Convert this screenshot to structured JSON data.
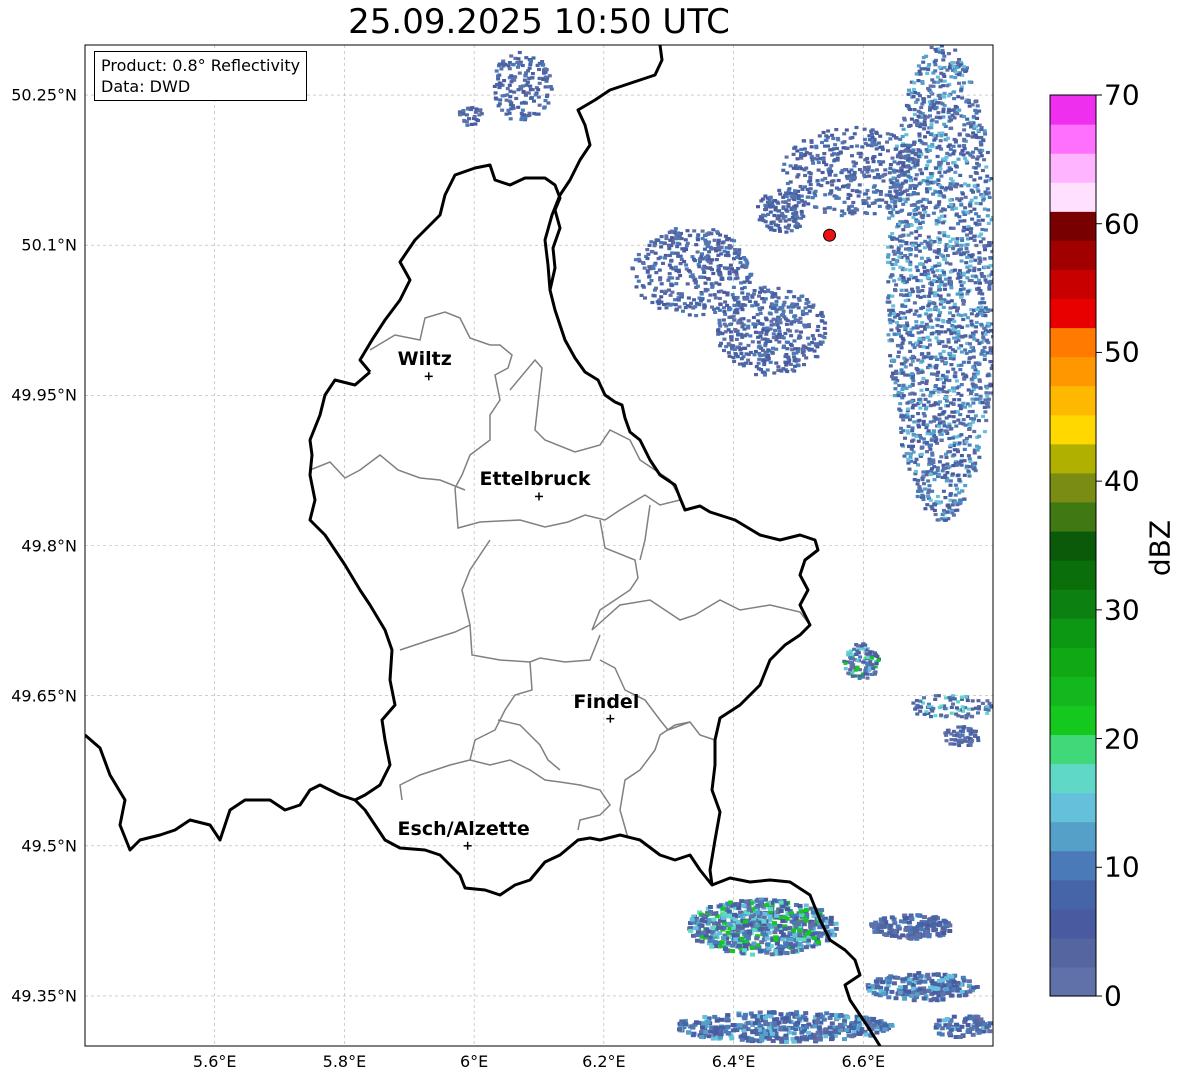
{
  "title": "25.09.2025 10:50 UTC",
  "info": {
    "product": "Product: 0.8° Reflectivity",
    "data": "Data: DWD"
  },
  "map": {
    "lon_range": [
      5.4,
      6.8
    ],
    "lat_range": [
      49.3,
      50.3
    ],
    "x_ticks": [
      {
        "value": 5.6,
        "label": "5.6°E"
      },
      {
        "value": 5.8,
        "label": "5.8°E"
      },
      {
        "value": 6.0,
        "label": "6°E"
      },
      {
        "value": 6.2,
        "label": "6.2°E"
      },
      {
        "value": 6.4,
        "label": "6.4°E"
      },
      {
        "value": 6.6,
        "label": "6.6°E"
      }
    ],
    "y_ticks": [
      {
        "value": 50.25,
        "label": "50.25°N"
      },
      {
        "value": 50.1,
        "label": "50.1°N"
      },
      {
        "value": 49.95,
        "label": "49.95°N"
      },
      {
        "value": 49.8,
        "label": "49.8°N"
      },
      {
        "value": 49.65,
        "label": "49.65°N"
      },
      {
        "value": 49.5,
        "label": "49.5°N"
      },
      {
        "value": 49.35,
        "label": "49.35°N"
      }
    ],
    "grid": true,
    "cities": [
      {
        "name": "Wiltz",
        "lon": 5.93,
        "lat": 49.969
      },
      {
        "name": "Ettelbruck",
        "lon": 6.1,
        "lat": 49.849
      },
      {
        "name": "Findel",
        "lon": 6.21,
        "lat": 49.627
      },
      {
        "name": "Esch/Alzette",
        "lon": 5.99,
        "lat": 49.5
      }
    ],
    "radar_site": {
      "lon": 6.548,
      "lat": 50.11,
      "color": "#ee1111"
    }
  },
  "colorbar": {
    "label": "dBZ",
    "min": 0,
    "max": 70,
    "ticks": [
      {
        "value": 0,
        "label": "0"
      },
      {
        "value": 10,
        "label": "10"
      },
      {
        "value": 20,
        "label": "20"
      },
      {
        "value": 30,
        "label": "30"
      },
      {
        "value": 40,
        "label": "40"
      },
      {
        "value": 50,
        "label": "50"
      },
      {
        "value": 60,
        "label": "60"
      },
      {
        "value": 70,
        "label": "70"
      }
    ],
    "colors": [
      "#6070a8",
      "#5565a0",
      "#4a5aa0",
      "#4565a8",
      "#4a7ab8",
      "#55a0c8",
      "#65c0dc",
      "#60d8c8",
      "#40d878",
      "#14c81e",
      "#14b81e",
      "#10a814",
      "#0c9812",
      "#0c8010",
      "#0a6e0a",
      "#0a5a0a",
      "#407814",
      "#7a8c14",
      "#b0b000",
      "#ffd800",
      "#ffb800",
      "#ff9800",
      "#ff7a00",
      "#e80000",
      "#c80000",
      "#a00000",
      "#780000",
      "#ffe0ff",
      "#ffb4ff",
      "#ff70ff",
      "#ee30ee"
    ]
  }
}
